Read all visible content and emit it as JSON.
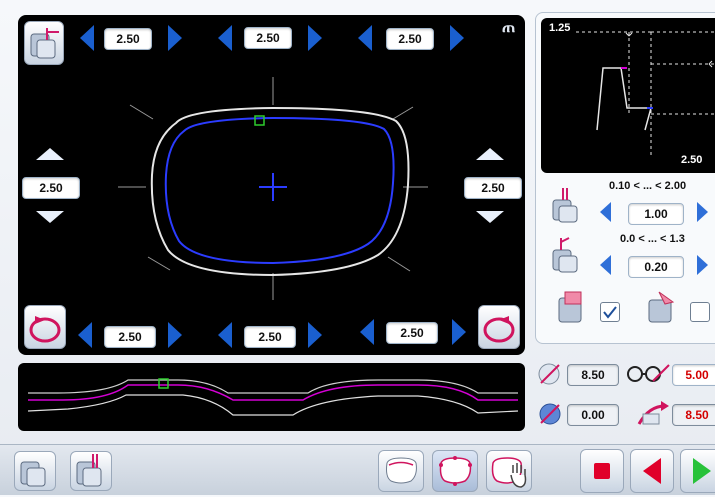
{
  "main": {
    "logo_text": "ጠ",
    "top_values": [
      "2.50",
      "2.50",
      "2.50"
    ],
    "side_left_value": "2.50",
    "side_right_value": "2.50",
    "bottom_values": [
      "2.50",
      "2.50",
      "2.50"
    ]
  },
  "profile": {
    "top_left_label": "1.25",
    "bottom_right_label": "2.50"
  },
  "settings": {
    "range1_label": "0.10 < ... < 2.00",
    "value1": "1.00",
    "range2_label": "0.0 < ... < 1.3",
    "value2": "0.20",
    "checkbox1_checked": true,
    "checkbox2_checked": false
  },
  "measurements": {
    "angle_value": "8.50",
    "glasses_value": "5.00",
    "diameter_value": "0.00",
    "tilt_value": "8.50"
  },
  "colors": {
    "accent_blue": "#1a5fcf",
    "lens_outline": "#2b3cff",
    "trace_magenta": "#d400d4",
    "marker_green": "#2ecc2e",
    "stop_red": "#e0002a",
    "play_green": "#27c23a"
  },
  "icons": [
    "lens-stack-icon",
    "lens-stack-2-icon",
    "lens-shape-icon",
    "lens-shape-dots-icon",
    "lens-hand-icon",
    "stop-icon",
    "back-icon",
    "play-icon",
    "glasses-icon"
  ]
}
